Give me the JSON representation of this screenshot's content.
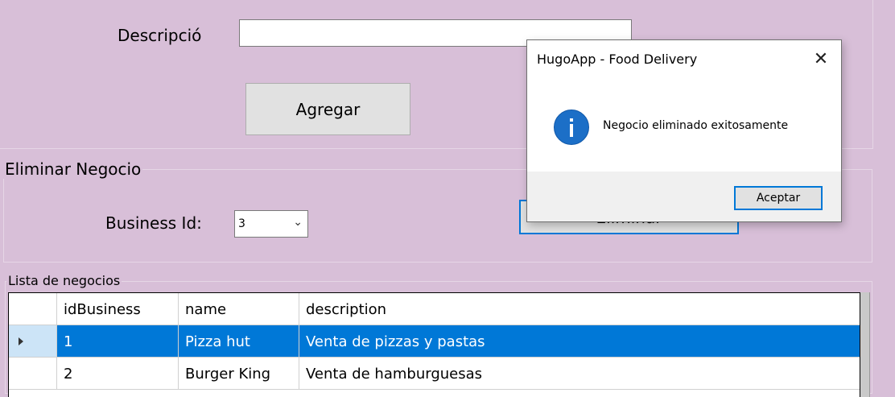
{
  "form": {
    "description_label": "Descripció",
    "description_value": "",
    "add_button": "Agregar"
  },
  "delete_group": {
    "title": "Eliminar Negocio",
    "business_id_label": "Business Id:",
    "business_id_value": "3",
    "delete_button": "Eliminar"
  },
  "list_group": {
    "title": "Lista de negocios",
    "columns": [
      "idBusiness",
      "name",
      "description"
    ],
    "rows": [
      {
        "idBusiness": "1",
        "name": "Pizza hut",
        "description": "Venta de pizzas y pastas",
        "selected": true
      },
      {
        "idBusiness": "2",
        "name": "Burger King",
        "description": "Venta de hamburguesas",
        "selected": false
      }
    ]
  },
  "dialog": {
    "title": "HugoApp - Food Delivery",
    "message": "Negocio eliminado exitosamente",
    "ok_button": "Aceptar",
    "icon": "info-icon",
    "accent_color": "#0078d7"
  }
}
